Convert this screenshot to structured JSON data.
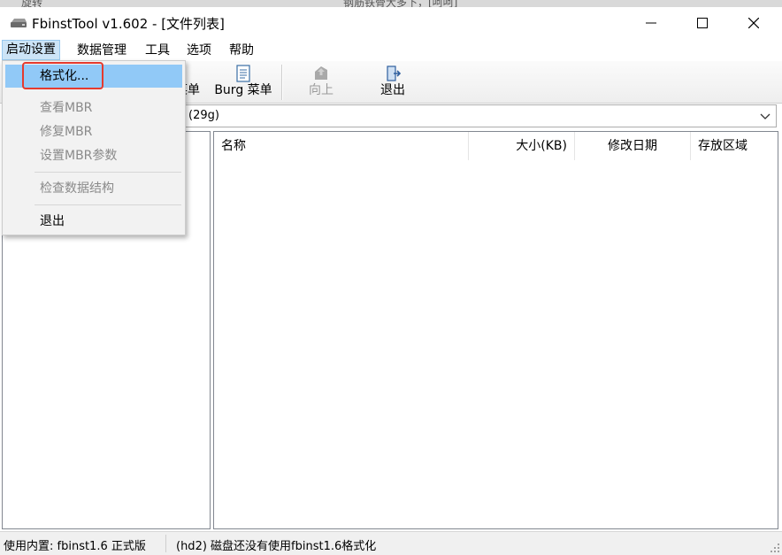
{
  "background_snippets": {
    "left": "旋转",
    "middle": "钢筋铁骨大多下，[呵呵]"
  },
  "window": {
    "title": "FbinstTool v1.602 - [文件列表]",
    "icon": "drive-icon"
  },
  "menubar": {
    "items": [
      "启动设置",
      "数据管理",
      "工具",
      "选项",
      "帮助"
    ]
  },
  "toolbar": {
    "partial_label": "菜单",
    "burg_label": "Burg 菜单",
    "up_label": "向上",
    "exit_label": "退出"
  },
  "disk": {
    "selected": "(29g)"
  },
  "file_list": {
    "columns": [
      "名称",
      "大小(KB)",
      "修改日期",
      "存放区域"
    ],
    "rows": []
  },
  "status": {
    "left": "使用内置: fbinst1.6 正式版",
    "right": "(hd2) 磁盘还没有使用fbinst1.6格式化"
  },
  "dropdown": {
    "format": "格式化...",
    "view_mbr": "查看MBR",
    "fix_mbr": "修复MBR",
    "mbr_params": "设置MBR参数",
    "check_structure": "检查数据结构",
    "exit": "退出"
  },
  "colors": {
    "highlight_border": "#e53a2e",
    "selected_item": "#91c9f7",
    "menu_active": "#cce4f7"
  }
}
